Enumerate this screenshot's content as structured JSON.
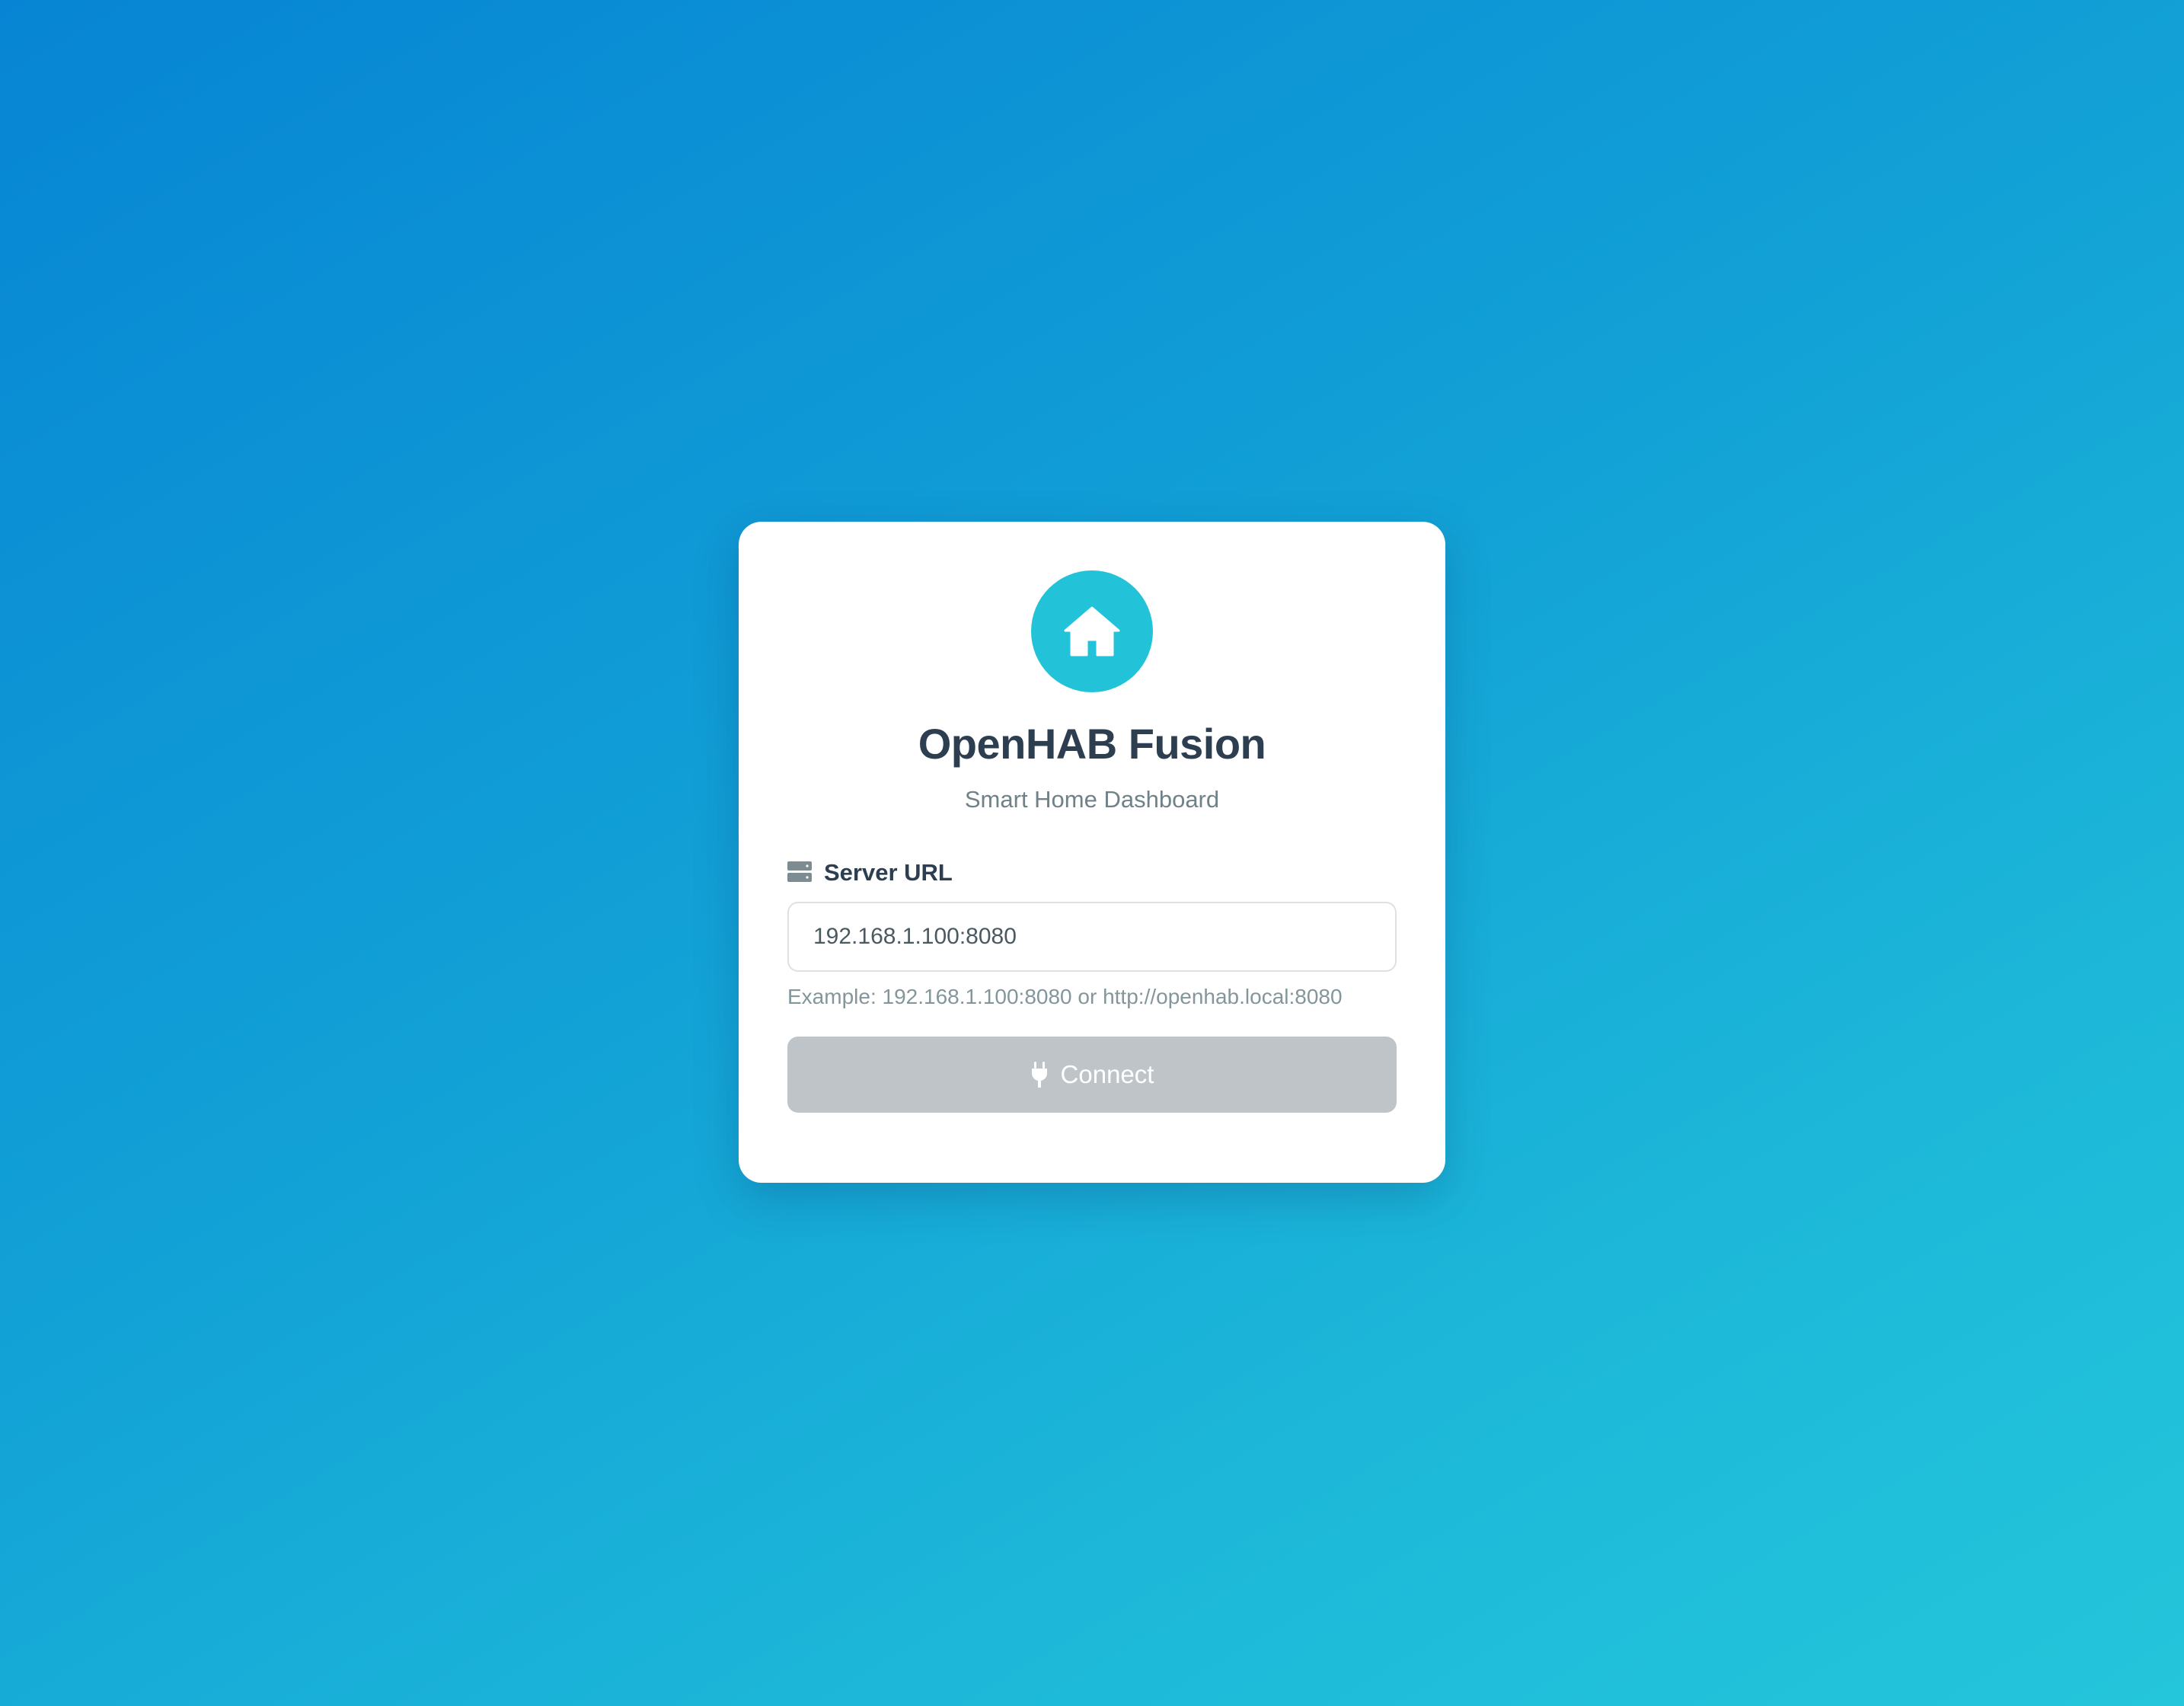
{
  "app": {
    "logo_icon": "home-icon",
    "title": "OpenHAB Fusion",
    "subtitle": "Smart Home Dashboard"
  },
  "form": {
    "server_url": {
      "icon": "server-icon",
      "label": "Server URL",
      "value": "192.168.1.100:8080",
      "hint": "Example: 192.168.1.100:8080 or http://openhab.local:8080"
    },
    "connect_button": {
      "icon": "plug-icon",
      "label": "Connect",
      "disabled": true
    }
  },
  "colors": {
    "background_start": "#0785d4",
    "background_end": "#24c6db",
    "logo_circle": "#22c3d8",
    "title_text": "#2c3e50",
    "button_disabled": "#bfc4c8"
  }
}
